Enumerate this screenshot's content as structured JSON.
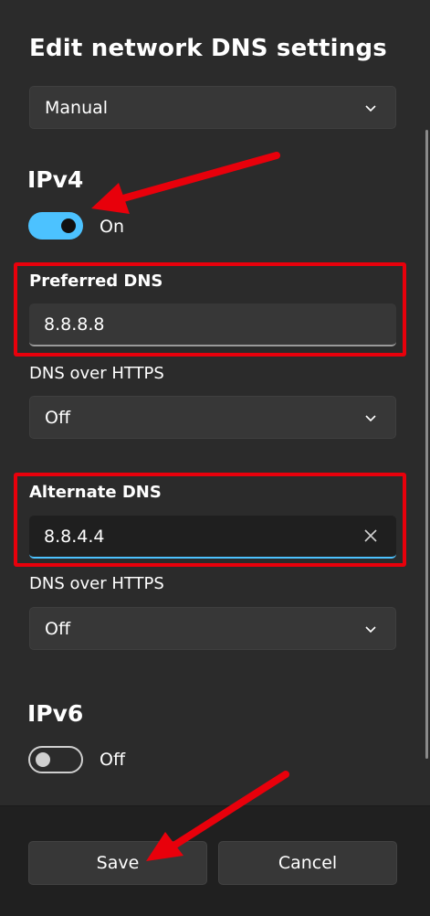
{
  "dialog": {
    "title": "Edit network DNS settings",
    "mode_select": {
      "value": "Manual"
    }
  },
  "ipv4": {
    "heading": "IPv4",
    "toggle": {
      "state": "On",
      "on": true
    },
    "preferred": {
      "label": "Preferred DNS",
      "value": "8.8.8.8"
    },
    "preferred_https": {
      "label": "DNS over HTTPS",
      "value": "Off"
    },
    "alternate": {
      "label": "Alternate DNS",
      "value": "8.8.4.4"
    },
    "alternate_https": {
      "label": "DNS over HTTPS",
      "value": "Off"
    }
  },
  "ipv6": {
    "heading": "IPv6",
    "toggle": {
      "state": "Off",
      "on": false
    }
  },
  "footer": {
    "save_label": "Save",
    "cancel_label": "Cancel"
  },
  "colors": {
    "accent": "#4cc2ff",
    "annotation": "#e8000b",
    "background": "#2b2b2b",
    "footer": "#202020"
  },
  "icons": [
    "chevron-down-icon",
    "close-icon",
    "annotation-arrow"
  ]
}
